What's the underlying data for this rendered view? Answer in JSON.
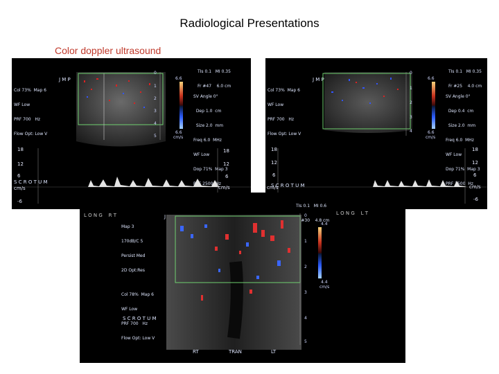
{
  "title": "Radiological Presentations",
  "subtitle": "Color doppler ultrasound",
  "panels": {
    "top_left": {
      "header": [
        "TIs 0.1   MI 0.35",
        "Fr #47    6.0 cm"
      ],
      "jmp": "J M P",
      "settings": [
        "Col 73%  Map 6",
        "WF Low",
        "PRF 700   Hz",
        "Flow Opt: Low V"
      ],
      "doppler": [
        "SV Angle 0°",
        "  Dep 1.0  cm",
        "  Size 2.0  mm",
        "Freq 6.0  MHz",
        "WF Low",
        "Dop 71%  Map 3",
        "PRF 2500  Hz"
      ],
      "depth": [
        "0",
        "1",
        "2",
        "3",
        "4",
        "5"
      ],
      "scale": [
        "6.6",
        "6.6",
        "cm/s"
      ],
      "spectral_left": [
        "18",
        "12",
        "6",
        "cm/s",
        "-6"
      ],
      "spectral_right": [
        "18",
        "12",
        "6",
        "cm/s"
      ],
      "scrotum": "S C R O T U M",
      "long": "L O N G    R T"
    },
    "top_right": {
      "header": [
        "TIs 0.1   MI 0.35",
        "Fr #25    4.0 cm"
      ],
      "jmp": "J M P",
      "settings": [
        "Col 73%  Map 6",
        "WF Low",
        "PRF 700   Hz",
        "Flow Opt: Low V"
      ],
      "doppler": [
        "SV Angle 0°",
        "  Dep 0.4  cm",
        "  Size 2.0  mm",
        "Freq 6.0  MHz",
        "WF Low",
        "Dop 71%  Map 3",
        "PRF 2500  Hz"
      ],
      "depth": [
        "0",
        "1",
        "2",
        "3",
        "4"
      ],
      "scale": [
        "6.6",
        "6.6",
        "cm/s"
      ],
      "spectral_left": [
        "18",
        "12",
        "6",
        "cm/s"
      ],
      "spectral_right": [
        "18",
        "12",
        "6",
        "cm/s",
        "-6"
      ],
      "scrotum": "S C R O T U M",
      "long": "L O N G    L T"
    },
    "bottom": {
      "header": [
        "TIs 0.1   MI 0.6",
        "Fr #30    4.8 cm"
      ],
      "jmp": "J M P",
      "settings": [
        "Map 3",
        "170dB/C 5",
        "Persist Med",
        "2D Opt:Res",
        "",
        "Col 78%  Map 6",
        "WF Low",
        "PRF 700   Hz",
        "Flow Opt: Low V"
      ],
      "depth": [
        "0",
        "1",
        "2",
        "3",
        "4",
        "5"
      ],
      "scale": [
        "4.4",
        "4.4",
        "cm/s"
      ],
      "scrotum": "S C R O T U M",
      "bottom_labels": [
        "RT",
        "TRAN",
        "LT"
      ]
    }
  }
}
